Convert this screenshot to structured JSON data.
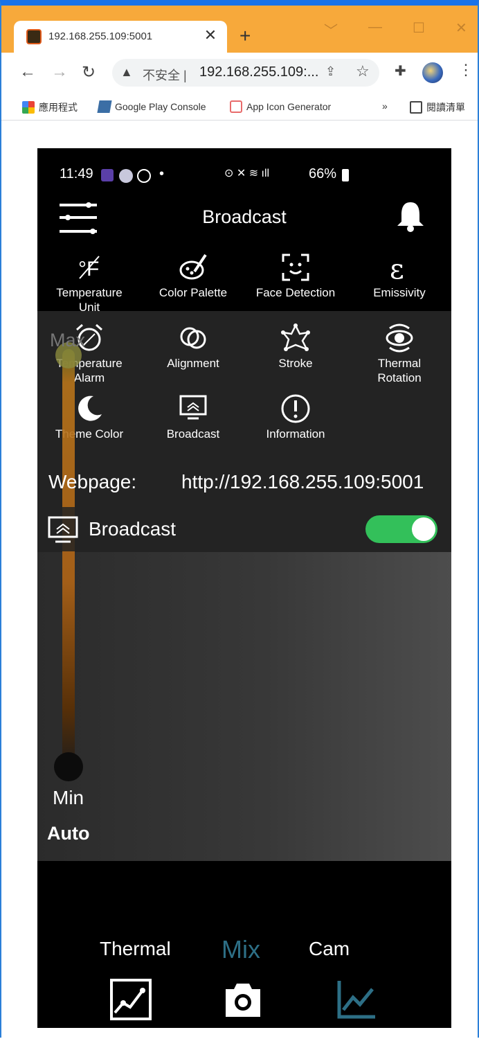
{
  "browser": {
    "tab": {
      "title": "192.168.255.109:5001",
      "close": "✕"
    },
    "new_tab": "+",
    "window_controls": {
      "chevron": "﹀",
      "minimize": "—",
      "maximize": "☐",
      "close": "✕"
    },
    "nav": {
      "back": "←",
      "forward": "→",
      "reload": "↻"
    },
    "omnibox": {
      "security": "不安全",
      "separator": "|",
      "url": "192.168.255.109:..."
    },
    "menu": "⋮",
    "bookmarks": [
      {
        "label": "應用程式"
      },
      {
        "label": "Google Play Console"
      },
      {
        "label": "App Icon Generator"
      }
    ],
    "bookmarks_more": "»",
    "reading_list": "閱讀清單"
  },
  "phone": {
    "status": {
      "time": "11:49",
      "dot": "•",
      "battery": "66%"
    },
    "app_title": "Broadcast",
    "menu_items": [
      {
        "label": "Temperature\nUnit",
        "icon": "temperature-unit-icon"
      },
      {
        "label": "Color Palette",
        "icon": "palette-icon"
      },
      {
        "label": "Face Detection",
        "icon": "face-detection-icon"
      },
      {
        "label": "Emissivity",
        "icon": "emissivity-icon"
      },
      {
        "label": "Temperature\nAlarm",
        "icon": "alarm-icon"
      },
      {
        "label": "Alignment",
        "icon": "alignment-icon"
      },
      {
        "label": "Stroke",
        "icon": "stroke-icon"
      },
      {
        "label": "Thermal\nRotation",
        "icon": "rotation-icon"
      },
      {
        "label": "Theme Color",
        "icon": "moon-icon"
      },
      {
        "label": "Broadcast",
        "icon": "broadcast-icon"
      },
      {
        "label": "Information",
        "icon": "info-icon"
      }
    ],
    "webpage": {
      "label": "Webpage:",
      "url": "http://192.168.255.109:5001"
    },
    "broadcast_toggle": {
      "label": "Broadcast",
      "on": true
    },
    "slider": {
      "max": "Max",
      "min": "Min",
      "mode": "Auto"
    },
    "modes": [
      {
        "label": "Thermal",
        "active": false
      },
      {
        "label": "Mix",
        "active": true
      },
      {
        "label": "Cam",
        "active": false
      }
    ],
    "colors": {
      "accent": "#2d6f86",
      "toggle": "#33c05a",
      "tabstrip": "#f7a93b"
    }
  }
}
